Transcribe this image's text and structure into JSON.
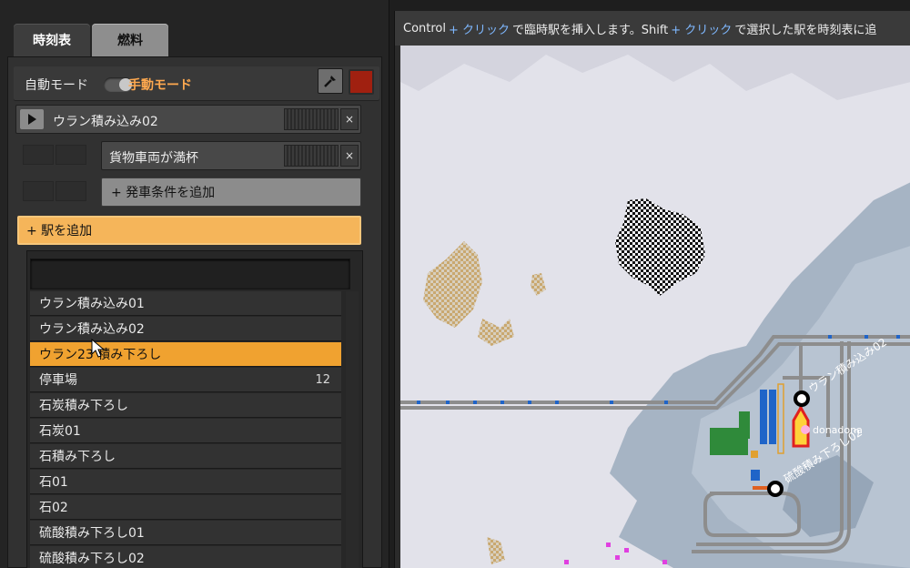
{
  "tabs": {
    "timetable": "時刻表",
    "fuel": "燃料"
  },
  "mode": {
    "auto_label": "自動モード",
    "manual_label": "手動モード",
    "switch_on": "manual"
  },
  "schedule": {
    "station_name": "ウラン積み込み02",
    "condition": "貨物車両が満杯",
    "add_condition": "+ 発車条件を追加",
    "add_station": "+ 駅を追加",
    "close_glyph": "×"
  },
  "picker": {
    "search_value": "",
    "items": [
      {
        "label": "ウラン積み込み01",
        "count": ""
      },
      {
        "label": "ウラン積み込み02",
        "count": ""
      },
      {
        "label": "ウラン23 積み下ろし",
        "count": "",
        "selected": true
      },
      {
        "label": "停車場",
        "count": "12"
      },
      {
        "label": "石炭積み下ろし",
        "count": ""
      },
      {
        "label": "石炭01",
        "count": ""
      },
      {
        "label": "石積み下ろし",
        "count": ""
      },
      {
        "label": "石01",
        "count": ""
      },
      {
        "label": "石02",
        "count": ""
      },
      {
        "label": "硫酸積み下ろし01",
        "count": ""
      },
      {
        "label": "硫酸積み下ろし02",
        "count": ""
      }
    ]
  },
  "hint": {
    "part1": "Control",
    "accent1": "+ クリック",
    "part2": "で臨時駅を挿入します。Shift",
    "accent2": "+ クリック",
    "part3": "で選択した駅を時刻表に追"
  },
  "map": {
    "station_label_1": "ウラン積み込み02",
    "station_label_2": "硫酸積み下ろし02",
    "player_label": "donadona"
  },
  "colors": {
    "accent": "#f5b55a",
    "selected": "#f0a230",
    "train_color": "#a02010"
  }
}
